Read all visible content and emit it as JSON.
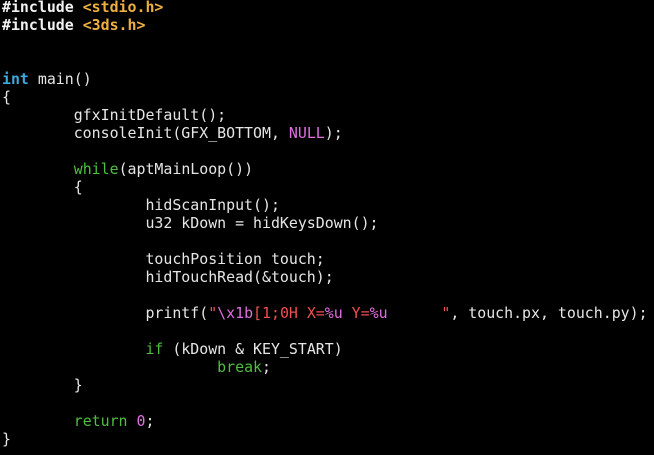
{
  "colors": {
    "background": "#000000",
    "plain": "#e6e6e6",
    "preproc": "#f2f2f2",
    "header": "#f0b040",
    "type_keyword": "#3fa8dc",
    "control_keyword": "#4fbf3f",
    "constant": "#e070e0",
    "string": "#f05050",
    "format": "#e070e0"
  },
  "editor": {
    "lines": [
      {
        "row": 0,
        "tokens": [
          {
            "text": "#include ",
            "kind": "preproc",
            "bold": true
          },
          {
            "text": "<stdio.h>",
            "kind": "header",
            "bold": true
          }
        ]
      },
      {
        "row": 1,
        "tokens": [
          {
            "text": "#include ",
            "kind": "preproc",
            "bold": true
          },
          {
            "text": "<3ds.h>",
            "kind": "header",
            "bold": true
          }
        ]
      },
      {
        "row": 4,
        "tokens": [
          {
            "text": "int",
            "kind": "type_keyword",
            "bold": true
          },
          {
            "text": " main()",
            "kind": "plain"
          }
        ]
      },
      {
        "row": 5,
        "tokens": [
          {
            "text": "{",
            "kind": "plain"
          }
        ]
      },
      {
        "row": 6,
        "tokens": [
          {
            "text": "        gfxInitDefault();",
            "kind": "plain"
          }
        ]
      },
      {
        "row": 7,
        "tokens": [
          {
            "text": "        consoleInit(GFX_BOTTOM, ",
            "kind": "plain"
          },
          {
            "text": "NULL",
            "kind": "constant"
          },
          {
            "text": ");",
            "kind": "plain"
          }
        ]
      },
      {
        "row": 9,
        "tokens": [
          {
            "text": "        ",
            "kind": "plain"
          },
          {
            "text": "while",
            "kind": "control_keyword"
          },
          {
            "text": "(aptMainLoop())",
            "kind": "plain"
          }
        ]
      },
      {
        "row": 10,
        "tokens": [
          {
            "text": "        {",
            "kind": "plain"
          }
        ]
      },
      {
        "row": 11,
        "tokens": [
          {
            "text": "                hidScanInput();",
            "kind": "plain"
          }
        ]
      },
      {
        "row": 12,
        "tokens": [
          {
            "text": "                u32 kDown = hidKeysDown();",
            "kind": "plain"
          }
        ]
      },
      {
        "row": 14,
        "tokens": [
          {
            "text": "                touchPosition touch;",
            "kind": "plain"
          }
        ]
      },
      {
        "row": 15,
        "tokens": [
          {
            "text": "                hidTouchRead(&touch);",
            "kind": "plain"
          }
        ]
      },
      {
        "row": 17,
        "tokens": [
          {
            "text": "                printf(",
            "kind": "plain"
          },
          {
            "text": "\"",
            "kind": "string"
          },
          {
            "text": "\\x1b",
            "kind": "format"
          },
          {
            "text": "[1;0H X=",
            "kind": "string"
          },
          {
            "text": "%u",
            "kind": "format"
          },
          {
            "text": " Y=",
            "kind": "string"
          },
          {
            "text": "%u",
            "kind": "format"
          },
          {
            "text": "      \"",
            "kind": "string"
          },
          {
            "text": ", touch.px, touch.py);",
            "kind": "plain"
          }
        ]
      },
      {
        "row": 19,
        "tokens": [
          {
            "text": "                ",
            "kind": "plain"
          },
          {
            "text": "if",
            "kind": "control_keyword"
          },
          {
            "text": " (kDown & KEY_START)",
            "kind": "plain"
          }
        ]
      },
      {
        "row": 20,
        "tokens": [
          {
            "text": "                        ",
            "kind": "plain"
          },
          {
            "text": "break",
            "kind": "control_keyword"
          },
          {
            "text": ";",
            "kind": "plain"
          }
        ]
      },
      {
        "row": 21,
        "tokens": [
          {
            "text": "        }",
            "kind": "plain"
          }
        ]
      },
      {
        "row": 23,
        "tokens": [
          {
            "text": "        ",
            "kind": "plain"
          },
          {
            "text": "return",
            "kind": "control_keyword"
          },
          {
            "text": " ",
            "kind": "plain"
          },
          {
            "text": "0",
            "kind": "constant"
          },
          {
            "text": ";",
            "kind": "plain"
          }
        ]
      },
      {
        "row": 24,
        "tokens": [
          {
            "text": "}",
            "kind": "plain"
          }
        ]
      }
    ]
  }
}
